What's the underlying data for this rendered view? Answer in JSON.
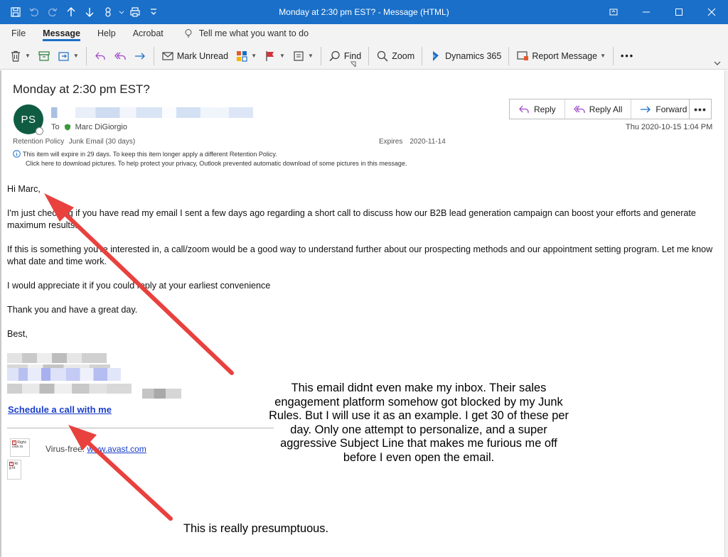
{
  "window": {
    "title": "Monday at 2:30 pm EST?  -  Message (HTML)"
  },
  "colors": {
    "titlebar": "#1a6fc8",
    "avatar": "#0f5c43",
    "link": "#1a3fc8",
    "arrow": "#e8413e"
  },
  "menu": {
    "items": [
      "File",
      "Message",
      "Help",
      "Acrobat"
    ],
    "active": "Message",
    "tell_me": "Tell me what you want to do"
  },
  "ribbon": {
    "mark_unread": "Mark Unread",
    "find": "Find",
    "zoom": "Zoom",
    "dynamics": "Dynamics 365",
    "report": "Report Message"
  },
  "message": {
    "subject": "Monday at 2:30 pm EST?",
    "avatar_initials": "PS",
    "to_label": "To",
    "to_name": "Marc DiGiorgio",
    "date": "Thu 2020-10-15 1:04 PM",
    "retention_label": "Retention Policy",
    "retention_value": "Junk Email (30 days)",
    "expires_label": "Expires",
    "expires_value": "2020-11-14",
    "info_line1": "This item will expire in 29 days. To keep this item longer apply a different Retention Policy.",
    "info_line2": "Click here to download pictures. To help protect your privacy, Outlook prevented automatic download of some pictures in this message."
  },
  "actions": {
    "reply": "Reply",
    "reply_all": "Reply All",
    "forward": "Forward"
  },
  "body": {
    "greeting": "Hi Marc,",
    "p1": "I'm just checking if you have read my email I sent a few days ago regarding a short call to discuss how our B2B lead generation campaign can boost your efforts and generate maximum results.",
    "p2": "If this is something you're interested in, a call/zoom would be a good way to understand further about our prospecting methods and our appointment setting program. Let me know what date and time work.",
    "p3": "I would appreciate it if you could reply at your earliest convenience",
    "p4": "Thank you and have a great day.",
    "closing": "Best,",
    "schedule_link": "Schedule a call with me",
    "broken_img1": "Right-click to",
    "broken_img2": "Ri g ht",
    "virus_free": "Virus-free.",
    "avast_link": "www.avast.com"
  },
  "annotations": {
    "callout_main": "This email didnt even make my inbox.  Their sales engagement platform somehow got blocked by my Junk Rules.  But I will use it as an example.  I get 30 of these per day.  Only one attempt to personalize, and a super aggressive Subject Line that makes me furious me off before I even open the email.",
    "callout_bottom": "This is really presumptuous."
  }
}
